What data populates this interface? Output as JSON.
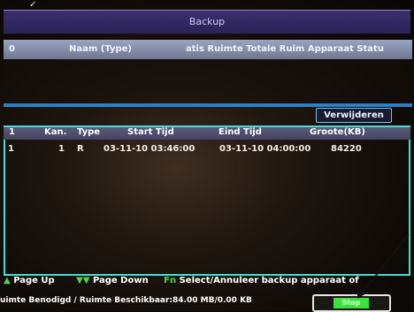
{
  "window": {
    "title": "Backup"
  },
  "upper_table": {
    "columns": [
      "0",
      "Naam (Type)",
      "atis Ruimte Totale Ruim Apparaat Statu"
    ]
  },
  "buttons": {
    "remove": "Verwijderen",
    "stop": "Stop"
  },
  "lower_table": {
    "columns": [
      "1",
      "Kan.",
      "Type",
      "Start Tijd",
      "Eind Tijd",
      "Groote(KB)"
    ],
    "rows": [
      {
        "num": "1",
        "check": "✓",
        "channel": "1",
        "type": "R",
        "start": "03-11-10 03:46:00",
        "end": "03-11-10 04:00:00",
        "size": "84220"
      }
    ]
  },
  "footer": {
    "page_up_key": "▲",
    "page_up": "Page Up",
    "page_down_key": "▼▼",
    "page_down": "Page Down",
    "select_key": "Fn",
    "select": "Select/Annuleer backup apparaat of",
    "space_info": "uimte Benodigd / Ruimte Beschikbaar:84.00 MB/0.00 KB"
  },
  "colors": {
    "accent_cyan": "#3fe0d6",
    "accent_blue": "#2d7fc4",
    "stop_green": "#3be23b"
  }
}
